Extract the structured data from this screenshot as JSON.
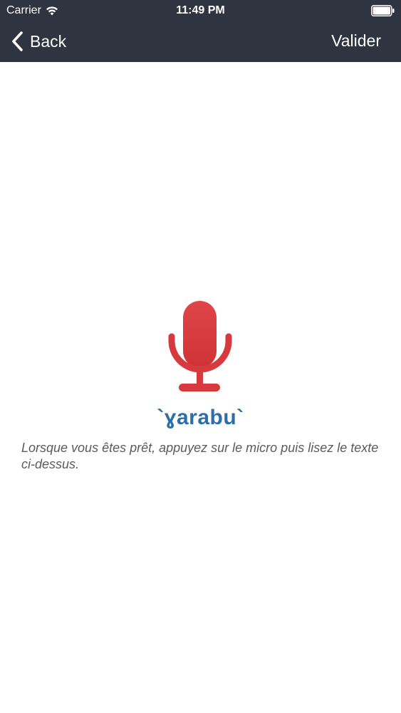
{
  "status_bar": {
    "carrier": "Carrier",
    "time": "11:49 PM"
  },
  "nav": {
    "back_label": "Back",
    "validate_label": "Valider"
  },
  "content": {
    "phrase": "`ɣarabu`",
    "instruction": "Lorsque vous êtes prêt, appuyez sur le micro puis lisez le texte ci-dessus."
  },
  "icons": {
    "microphone": "microphone-icon",
    "back": "chevron-left-icon",
    "wifi": "wifi-icon",
    "battery": "battery-icon"
  },
  "colors": {
    "nav_background": "#2e3440",
    "mic_red": "#d63a3e",
    "phrase_blue": "#2e6ea8",
    "instruction_gray": "#5b5b5b"
  }
}
